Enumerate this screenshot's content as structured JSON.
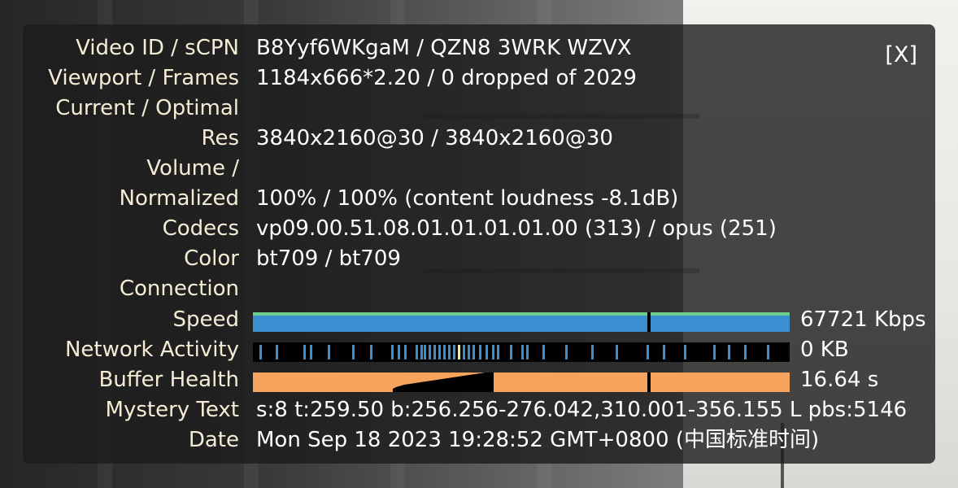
{
  "close_label": "[X]",
  "rows": [
    {
      "label": "Video ID / sCPN",
      "value": "B8Yyf6WKgaM / QZN8 3WRK WZVX"
    },
    {
      "label": "Viewport / Frames",
      "value": "1184x666*2.20 / 0 dropped of 2029"
    },
    {
      "label": "Current / Optimal",
      "value": ""
    },
    {
      "label": "Res",
      "value": "3840x2160@30 / 3840x2160@30"
    },
    {
      "label": "Volume /",
      "value": ""
    },
    {
      "label": "Normalized",
      "value": "100% / 100% (content loudness -8.1dB)"
    },
    {
      "label": "Codecs",
      "value": "vp09.00.51.08.01.01.01.01.00 (313) / opus (251)"
    },
    {
      "label": "Color",
      "value": "bt709 / bt709"
    },
    {
      "label": "Connection",
      "value": ""
    },
    {
      "label": "Speed",
      "value": "67721 Kbps"
    },
    {
      "label": "Network Activity",
      "value": "0 KB"
    },
    {
      "label": "Buffer Health",
      "value": "16.64 s"
    },
    {
      "label": "Mystery Text",
      "value": "s:8 t:259.50 b:256.256-276.042,310.001-356.155 L pbs:5146"
    },
    {
      "label": "Date",
      "value": "Mon Sep 18 2023 19:28:52 GMT+0800 (中国标准时间)"
    }
  ],
  "colors": {
    "label": "#f4ecd4",
    "speed_graph": "#3a8fd0",
    "speed_peak": "#6ccf8a",
    "network_tick": "#3a8fd0",
    "network_highlight": "#e8f09a",
    "buffer_graph": "#f6a35d"
  }
}
